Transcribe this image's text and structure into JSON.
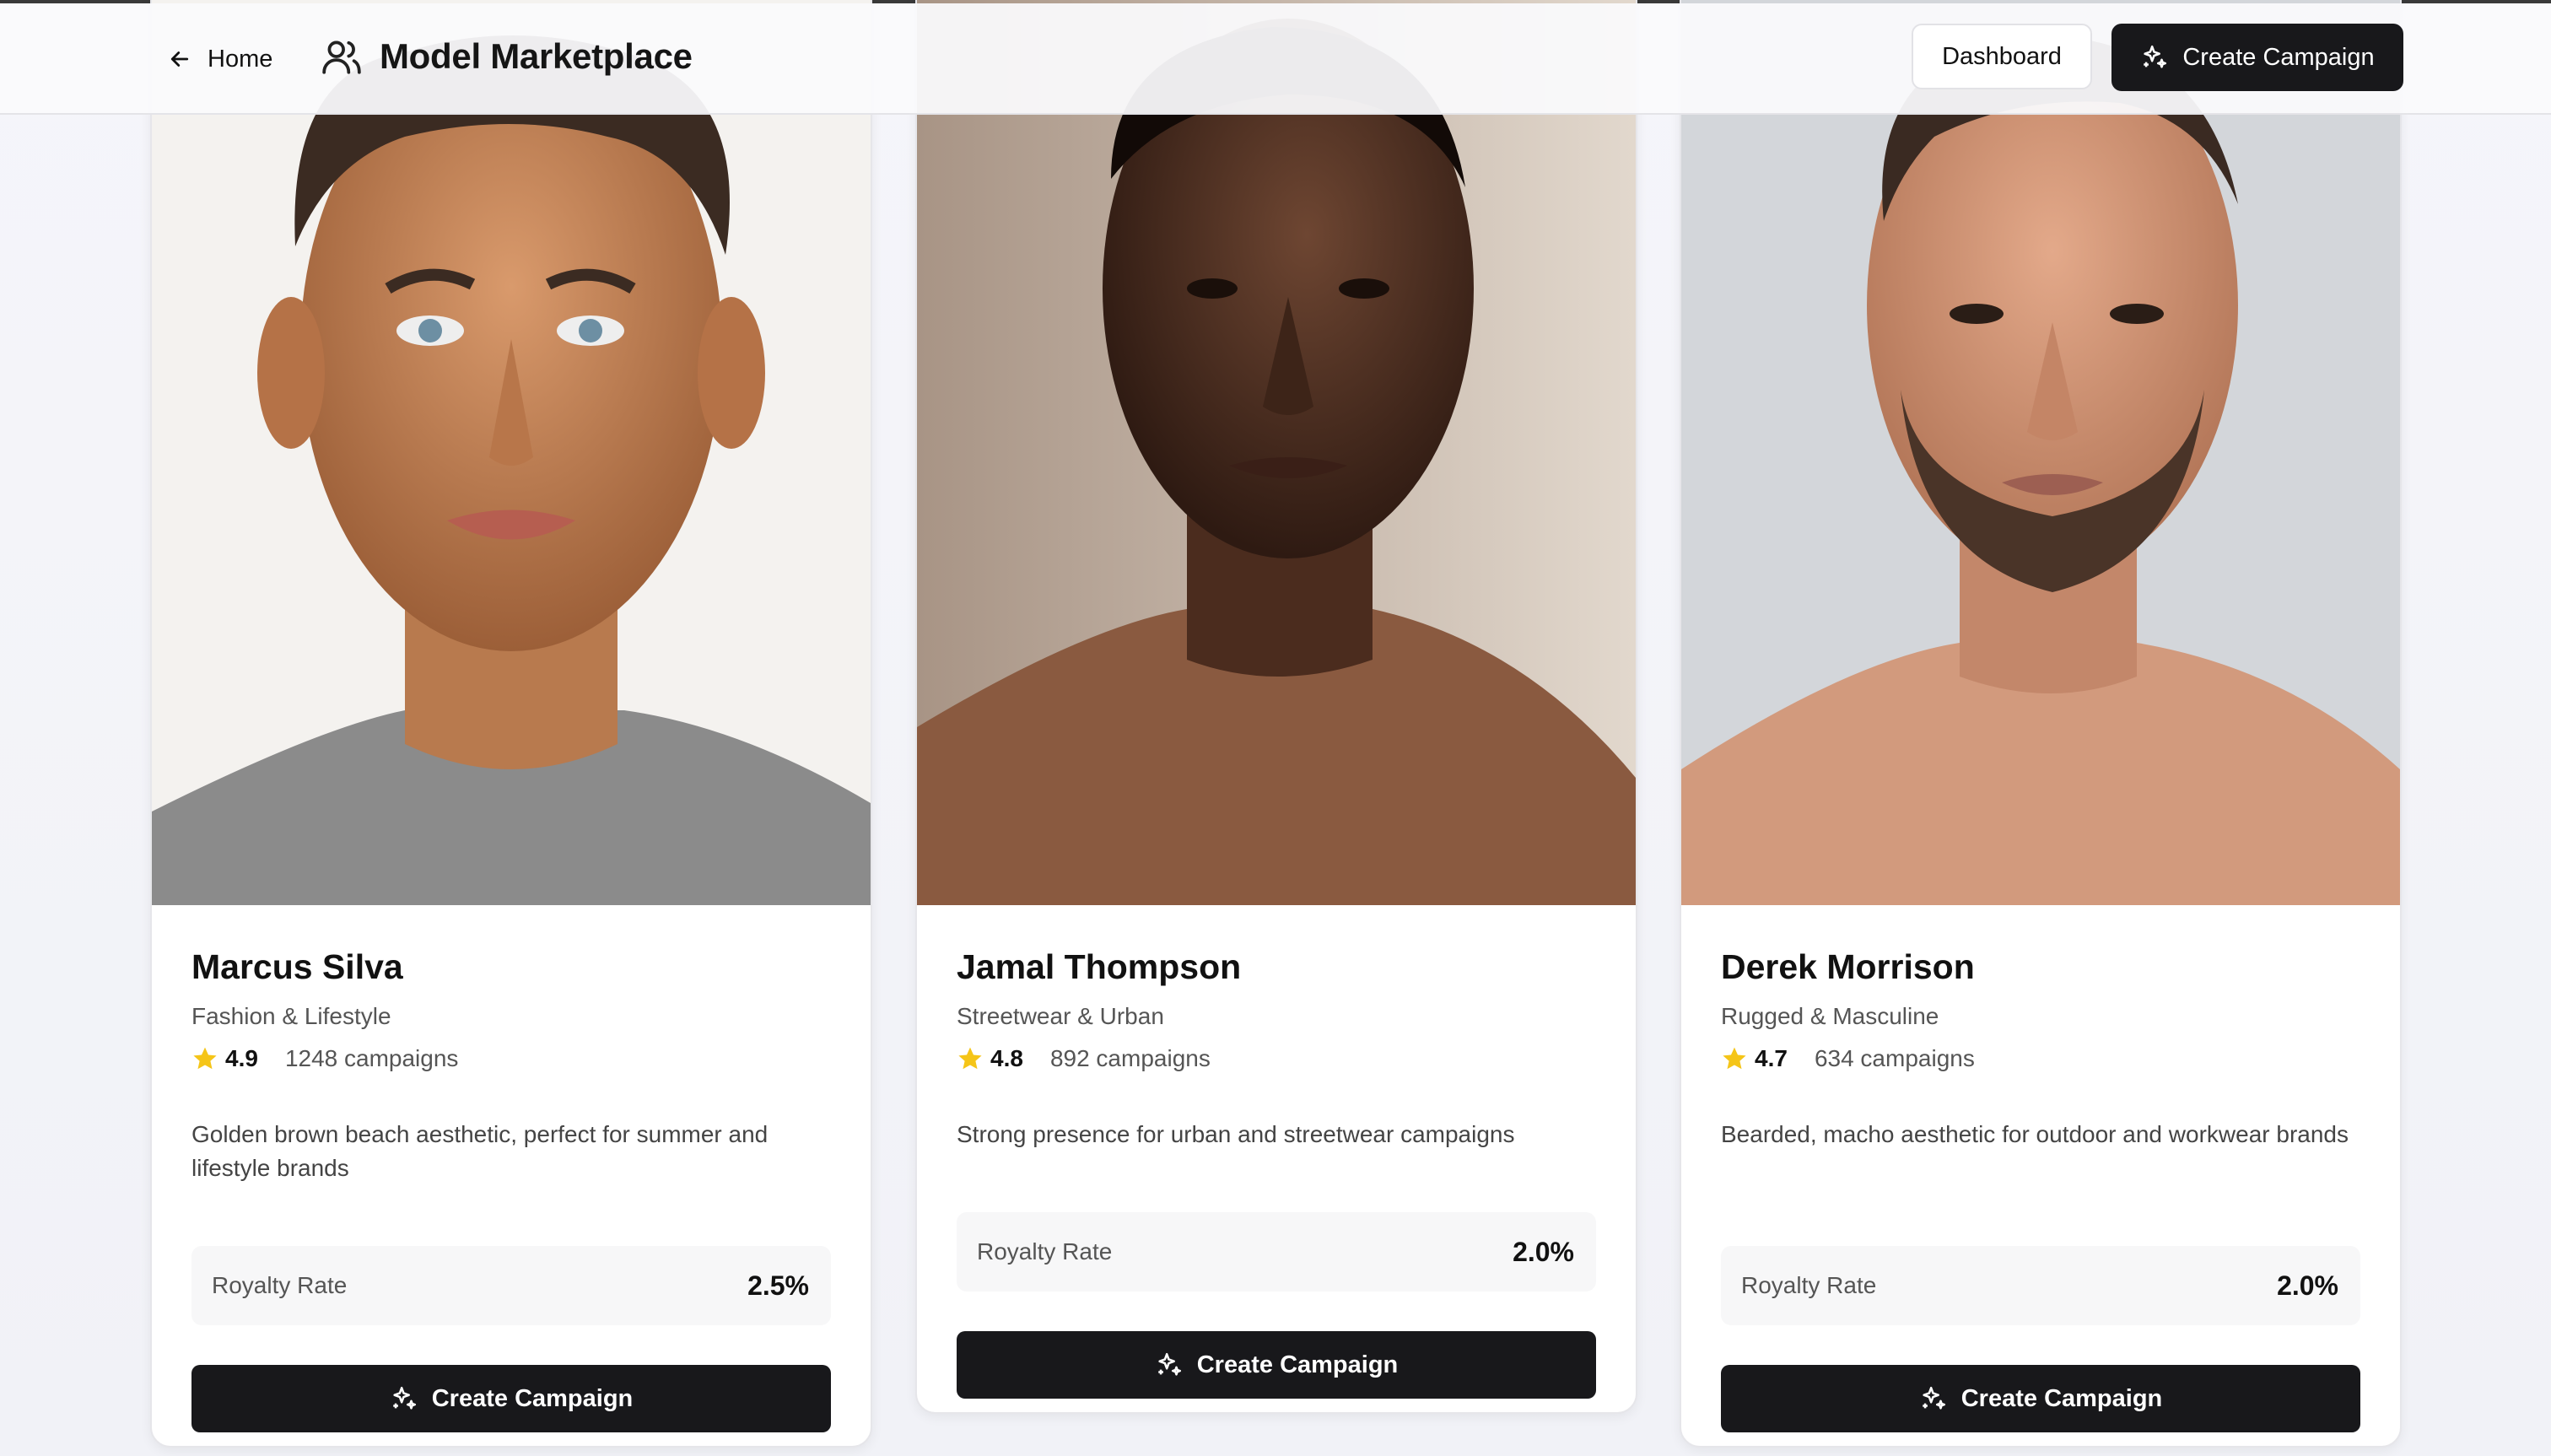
{
  "header": {
    "home_label": "Home",
    "title": "Model Marketplace",
    "dashboard_label": "Dashboard",
    "create_campaign_label": "Create Campaign"
  },
  "models": [
    {
      "name": "Marcus Silva",
      "category": "Fashion & Lifestyle",
      "rating": "4.9",
      "campaigns": "1248 campaigns",
      "description": "Golden brown beach aesthetic, perfect for summer and lifestyle brands",
      "royalty_label": "Royalty Rate",
      "royalty_value": "2.5%",
      "button_label": "Create Campaign"
    },
    {
      "name": "Jamal Thompson",
      "category": "Streetwear & Urban",
      "rating": "4.8",
      "campaigns": "892 campaigns",
      "description": "Strong presence for urban and streetwear campaigns",
      "royalty_label": "Royalty Rate",
      "royalty_value": "2.0%",
      "button_label": "Create Campaign"
    },
    {
      "name": "Derek Morrison",
      "category": "Rugged & Masculine",
      "rating": "4.7",
      "campaigns": "634 campaigns",
      "description": "Bearded, macho aesthetic for outdoor and workwear brands",
      "royalty_label": "Royalty Rate",
      "royalty_value": "2.0%",
      "button_label": "Create Campaign"
    }
  ],
  "colors": {
    "primary_button": "#18181b",
    "star": "#f5c518",
    "page_background": "#f3f3f8"
  },
  "icons": {
    "home": "arrow-left-icon",
    "brand": "users-icon",
    "create": "sparkles-icon",
    "rating": "star-icon"
  }
}
